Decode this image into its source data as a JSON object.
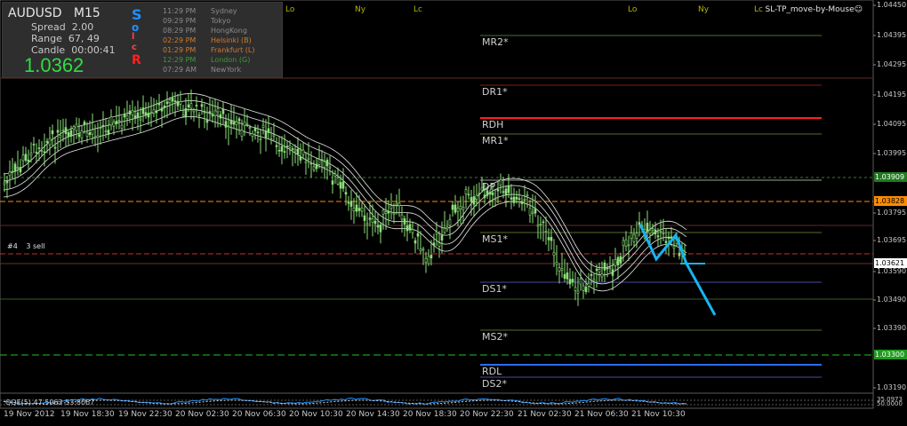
{
  "info": {
    "symbol": "AUDUSD",
    "timeframe": "M15",
    "spread_label": "Spread",
    "spread_value": "2.00",
    "range_label": "Range",
    "range_value": "67, 49",
    "candle_label": "Candle",
    "candle_value": "00:00:41",
    "bid": "1.0362",
    "letters": [
      "S",
      "o",
      "l",
      "c",
      "R"
    ],
    "letter_colors": [
      "#1e90ff",
      "#1e90ff",
      "#ff4040",
      "#ff4040",
      "#ff2020"
    ]
  },
  "sessions": [
    {
      "time": "11:29 PM",
      "city": "Sydney",
      "color": "#8a8a8a"
    },
    {
      "time": "09:29 PM",
      "city": "Tokyo",
      "color": "#8a8a8a"
    },
    {
      "time": "08:29 PM",
      "city": "HongKong",
      "color": "#8a8a8a"
    },
    {
      "time": "02:29 PM",
      "city": "Helsinki  (B)",
      "color": "#d07a2a"
    },
    {
      "time": "01:29 PM",
      "city": "Frankfurt  (L)",
      "color": "#d07a2a"
    },
    {
      "time": "12:29 PM",
      "city": "London  (G)",
      "color": "#3a9a3a"
    },
    {
      "time": "07:29 AM",
      "city": "NewYork",
      "color": "#8a8a8a"
    }
  ],
  "session_markers": [
    "Lo",
    "Ny",
    "Lc",
    "Lo",
    "Ny",
    "Lc"
  ],
  "corner_label": "SL-TP_move-by-Mouse☺",
  "oscillator_label": "QQE(5) 47.5062 53.8067",
  "price_axis": [
    "1.04450",
    "1.04395",
    "1.04295",
    "1.04195",
    "1.04095",
    "1.03995",
    "1.03795",
    "1.03695",
    "1.03590",
    "1.03490",
    "1.03390",
    "1.03190"
  ],
  "price_tags": [
    {
      "value": "1.03909",
      "bg": "#1f7a1f",
      "fg": "#ffffff"
    },
    {
      "value": "1.03828",
      "bg": "#ff8c00",
      "fg": "#000000"
    },
    {
      "value": "1.03621",
      "bg": "#ffffff",
      "fg": "#000000"
    },
    {
      "value": "1.03300",
      "bg": "#1f9a1f",
      "fg": "#ffffff"
    }
  ],
  "osc_tags": [
    "35.0973",
    "50.0000"
  ],
  "pivots": [
    "MR2*",
    "DR1*",
    "RDH",
    "MR1*",
    "DP",
    "MS1*",
    "DS1*",
    "MS2*",
    "RDL",
    "DS2*"
  ],
  "trade_label": "#4      3 sell",
  "time_axis": [
    "19 Nov 2012",
    "19 Nov 18:30",
    "19 Nov 22:30",
    "20 Nov 02:30",
    "20 Nov 06:30",
    "20 Nov 10:30",
    "20 Nov 14:30",
    "20 Nov 18:30",
    "20 Nov 22:30",
    "21 Nov 02:30",
    "21 Nov 06:30",
    "21 Nov 10:30"
  ]
}
